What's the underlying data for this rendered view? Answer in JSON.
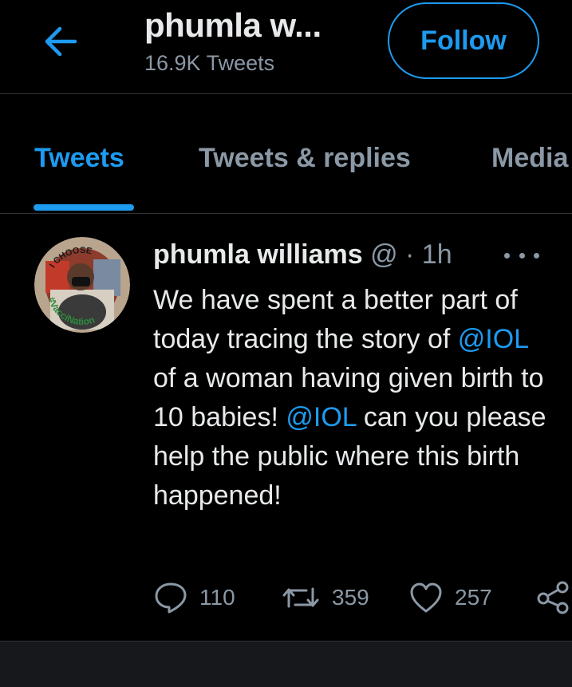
{
  "header": {
    "back_icon": "arrow-left-icon",
    "title": "phumla w...",
    "subtitle": "16.9K Tweets",
    "follow_label": "Follow"
  },
  "tabs": [
    {
      "label": "Tweets",
      "active": true
    },
    {
      "label": "Tweets & replies",
      "active": false
    },
    {
      "label": "Media",
      "active": false
    }
  ],
  "tweet": {
    "author_name": "phumla williams",
    "author_meta": " @ · 1h",
    "avatar_text_top": "I CHOOSE",
    "avatar_text_bottom": "#VacciNation",
    "body_part1": "We have spent a better part of today tracing the story of ",
    "mention1": "@IOL",
    "body_part2": "  of a woman having given birth to 10 babies! ",
    "mention2": "@IOL",
    "body_part3": " can you please help the public where this birth happened!",
    "actions": {
      "replies": "110",
      "retweets": "359",
      "likes": "257"
    }
  },
  "colors": {
    "accent": "#1d9bf0",
    "background": "#000000",
    "text": "#e7e9ea",
    "muted": "#8b98a5"
  }
}
